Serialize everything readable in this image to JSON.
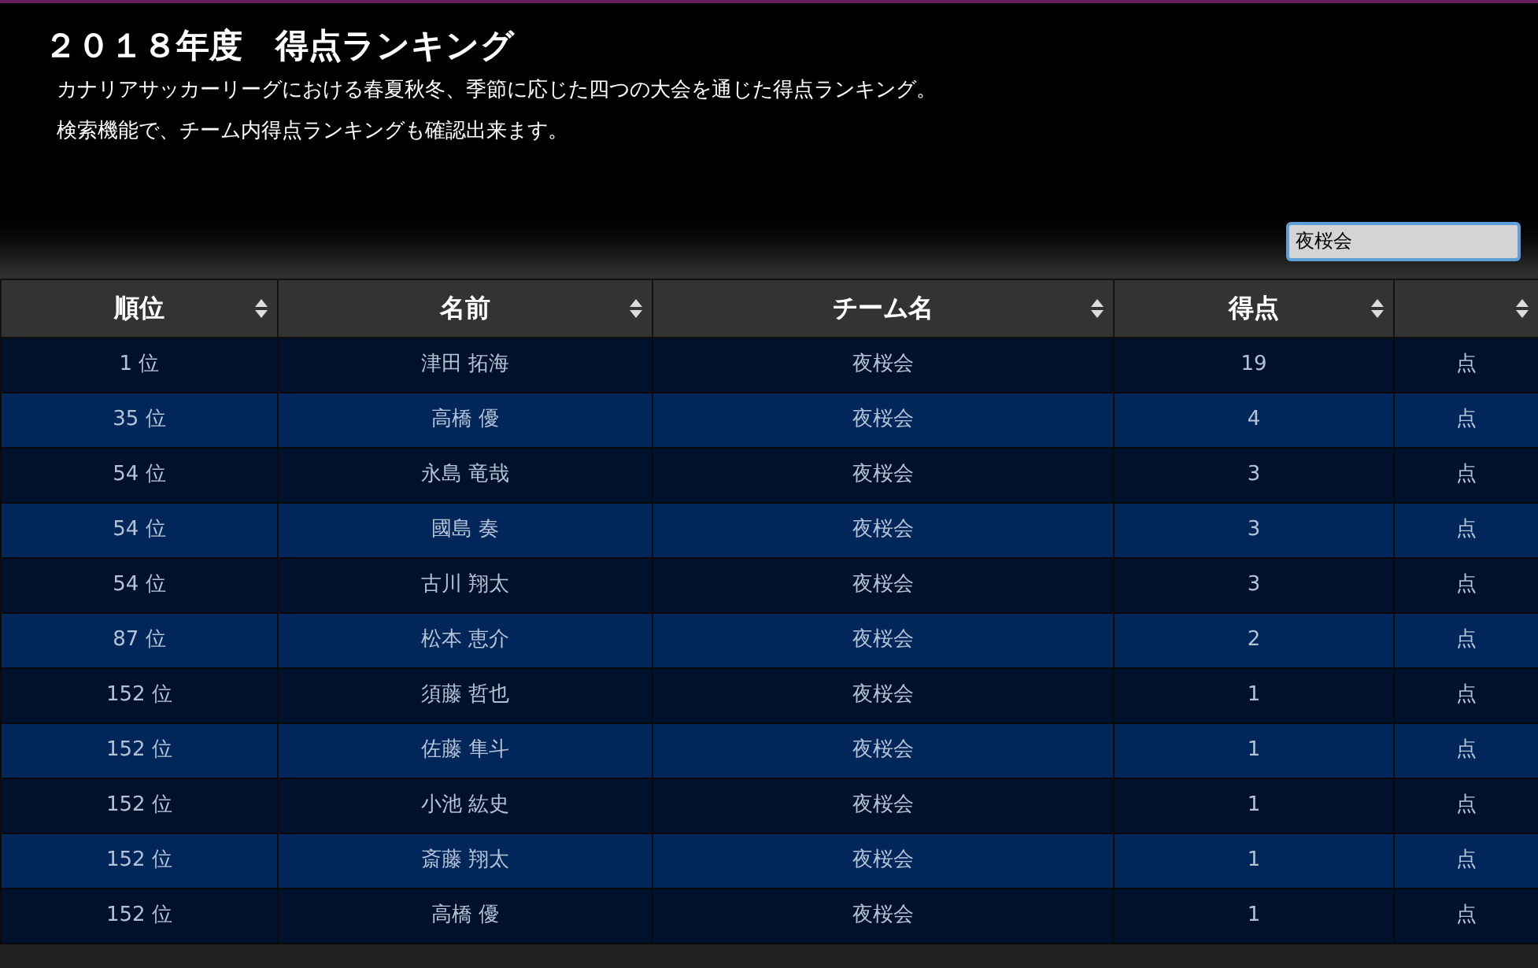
{
  "title": "２０１８年度　得点ランキング",
  "descriptions": [
    "カナリアサッカーリーグにおける春夏秋冬、季節に応じた四つの大会を通じた得点ランキング。",
    "検索機能で、チーム内得点ランキングも確認出来ます。"
  ],
  "search": {
    "value": "夜桜会"
  },
  "table": {
    "columns": [
      "順位",
      "名前",
      "チーム名",
      "得点",
      ""
    ],
    "rows": [
      [
        "1 位",
        "津田 拓海",
        "夜桜会",
        "19",
        "点"
      ],
      [
        "35 位",
        "高橋 優",
        "夜桜会",
        "4",
        "点"
      ],
      [
        "54 位",
        "永島 竜哉",
        "夜桜会",
        "3",
        "点"
      ],
      [
        "54 位",
        "國島 奏",
        "夜桜会",
        "3",
        "点"
      ],
      [
        "54 位",
        "古川 翔太",
        "夜桜会",
        "3",
        "点"
      ],
      [
        "87 位",
        "松本 恵介",
        "夜桜会",
        "2",
        "点"
      ],
      [
        "152 位",
        "須藤 哲也",
        "夜桜会",
        "1",
        "点"
      ],
      [
        "152 位",
        "佐藤 隼斗",
        "夜桜会",
        "1",
        "点"
      ],
      [
        "152 位",
        "小池 紘史",
        "夜桜会",
        "1",
        "点"
      ],
      [
        "152 位",
        "斎藤 翔太",
        "夜桜会",
        "1",
        "点"
      ],
      [
        "152 位",
        "高橋 優",
        "夜桜会",
        "1",
        "点"
      ]
    ]
  }
}
